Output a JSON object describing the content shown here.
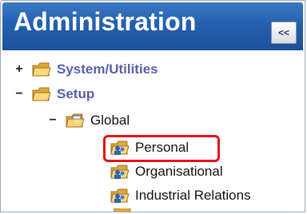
{
  "header": {
    "title": "Administration",
    "collapse_label": "<<"
  },
  "tree": {
    "items": [
      {
        "label": "System/Utilities",
        "toggle": "+"
      },
      {
        "label": "Setup",
        "toggle": "−"
      },
      {
        "label": "Global",
        "toggle": "−"
      },
      {
        "label": "Personal"
      },
      {
        "label": "Organisational"
      },
      {
        "label": "Industrial Relations"
      }
    ]
  },
  "colors": {
    "header": "#2560b0",
    "highlight": "#e4141b",
    "bold_label": "#5a5fa8"
  }
}
